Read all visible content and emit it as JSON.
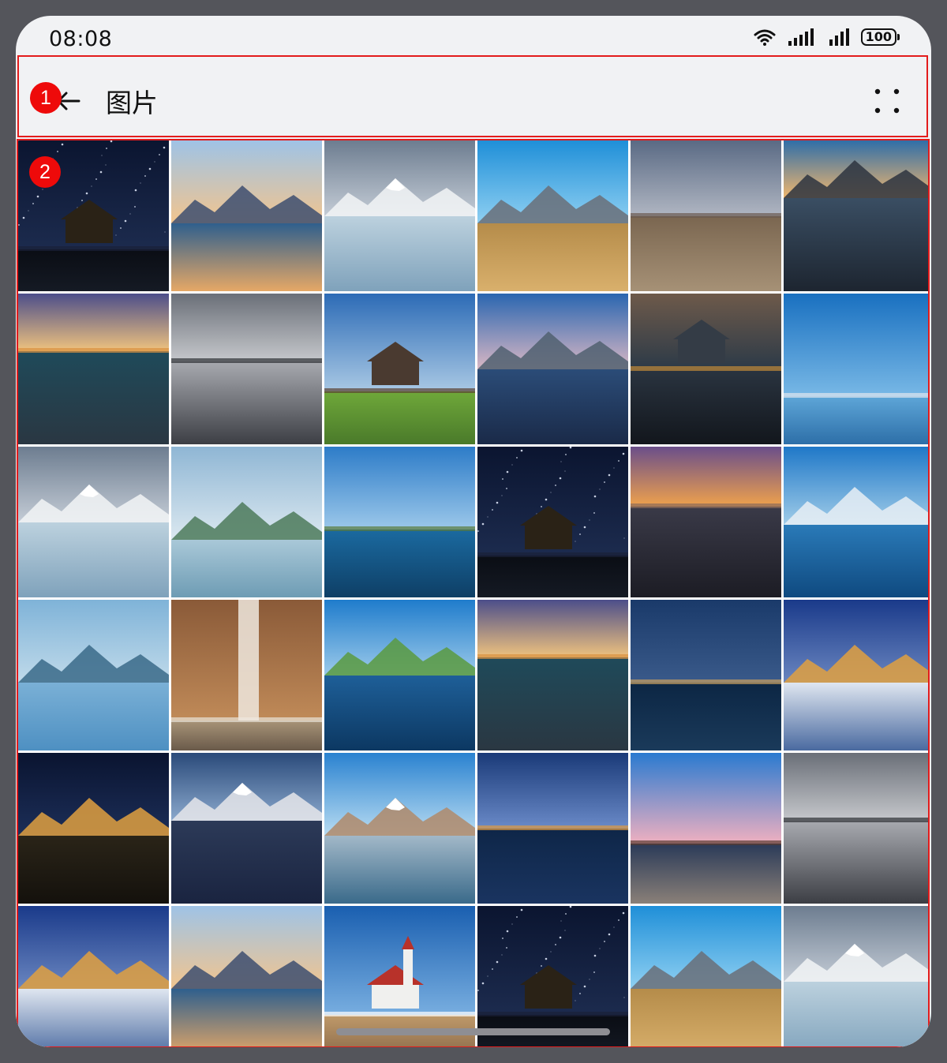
{
  "status_bar": {
    "time": "08:08",
    "battery": "100"
  },
  "app_bar": {
    "title": "图片",
    "back_icon": "arrow-left-icon",
    "more_icon": "more-dots-icon"
  },
  "markers": [
    "1",
    "2"
  ],
  "thumbnails": [
    "starry-night-cabin",
    "mountain-lake-sunset",
    "snowy-peak-reflection",
    "mountain-valley-blue-sky",
    "plains-dusk",
    "pebble-shore-sunset",
    "rocky-coast-purple-sky",
    "misty-rocks-coast",
    "bare-trees-farmhouse",
    "lake-blue-dusk",
    "smoky-village-trees",
    "calm-lake-horizon",
    "snowy-peak-reflection",
    "misty-karst-lake",
    "lake-island-trees",
    "starry-night-cabin",
    "rocky-coast-sunset",
    "mountain-lake-reflection",
    "misty-blue-lake",
    "canyon-waterfall",
    "green-hill-lake",
    "rocky-coast-purple-sky",
    "cliff-village-night",
    "snowy-village-night",
    "alpine-village-night",
    "snowy-mountain-town",
    "mountain-lake-clear",
    "cliff-town-dusk",
    "coastal-church-pink-sky",
    "misty-rocks-coast",
    "snowy-village-night",
    "mountain-lake-sunset",
    "white-church-blue-sky",
    "starry-night-cabin",
    "mountain-valley-blue-sky",
    "snowy-peak-reflection"
  ]
}
